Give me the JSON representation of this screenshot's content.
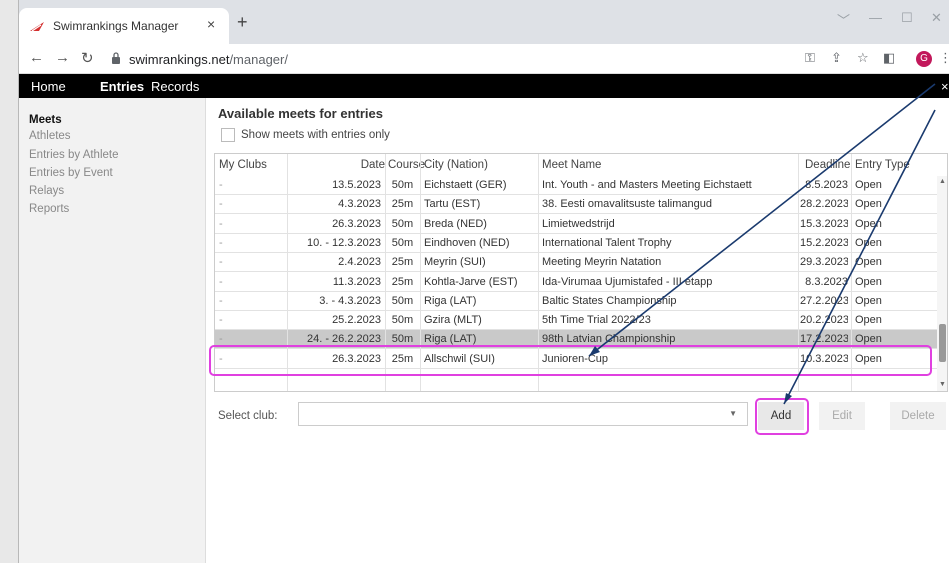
{
  "browser": {
    "tab_title": "Swimrankings Manager",
    "tab_close": "×",
    "new_tab": "+",
    "url_host": "swimrankings.net",
    "url_path": "/manager/",
    "avatar_letter": "G",
    "win_controls": [
      "﹀",
      "—",
      "☐",
      "✕"
    ]
  },
  "menubar": {
    "items": [
      {
        "label": "Home",
        "active": false
      },
      {
        "label": "Entries",
        "active": true
      },
      {
        "label": "Records",
        "active": false
      }
    ],
    "close": "×"
  },
  "sidebar": {
    "items": [
      {
        "label": "Meets",
        "active": true
      },
      {
        "label": "Athletes",
        "active": false
      },
      {
        "label": "Entries by Athlete",
        "active": false
      },
      {
        "label": "Entries by Event",
        "active": false
      },
      {
        "label": "Relays",
        "active": false
      },
      {
        "label": "Reports",
        "active": false
      }
    ]
  },
  "main": {
    "heading": "Available meets for entries",
    "checkbox_label": "Show meets with entries only",
    "columns": [
      "My Clubs",
      "Date",
      "Course",
      "City (Nation)",
      "Meet Name",
      "Deadline",
      "Entry Type"
    ],
    "rows": [
      {
        "club": "-",
        "date": "13.5.2023",
        "course": "50m",
        "city": "Eichstaett (GER)",
        "meet": "Int. Youth - and Masters Meeting Eichstaett",
        "deadline": "8.5.2023",
        "type": "Open"
      },
      {
        "club": "-",
        "date": "4.3.2023",
        "course": "25m",
        "city": "Tartu (EST)",
        "meet": "38. Eesti omavalitsuste talimangud",
        "deadline": "28.2.2023",
        "type": "Open"
      },
      {
        "club": "-",
        "date": "26.3.2023",
        "course": "50m",
        "city": "Breda (NED)",
        "meet": "Limietwedstrijd",
        "deadline": "15.3.2023",
        "type": "Open"
      },
      {
        "club": "-",
        "date": "10. - 12.3.2023",
        "course": "50m",
        "city": "Eindhoven (NED)",
        "meet": "International Talent Trophy",
        "deadline": "15.2.2023",
        "type": "Open"
      },
      {
        "club": "-",
        "date": "2.4.2023",
        "course": "25m",
        "city": "Meyrin (SUI)",
        "meet": "Meeting Meyrin Natation",
        "deadline": "29.3.2023",
        "type": "Open"
      },
      {
        "club": "-",
        "date": "11.3.2023",
        "course": "25m",
        "city": "Kohtla-Jarve (EST)",
        "meet": "Ida-Virumaa Ujumistafed - III etapp",
        "deadline": "8.3.2023",
        "type": "Open"
      },
      {
        "club": "-",
        "date": "3. - 4.3.2023",
        "course": "50m",
        "city": "Riga (LAT)",
        "meet": "Baltic States Championship",
        "deadline": "27.2.2023",
        "type": "Open"
      },
      {
        "club": "-",
        "date": "25.2.2023",
        "course": "50m",
        "city": "Gzira (MLT)",
        "meet": "5th Time Trial 2022/23",
        "deadline": "20.2.2023",
        "type": "Open"
      },
      {
        "club": "-",
        "date": "24. - 26.2.2023",
        "course": "50m",
        "city": "Riga (LAT)",
        "meet": "98th Latvian Championship",
        "deadline": "17.2.2023",
        "type": "Open",
        "selected": true
      },
      {
        "club": "-",
        "date": "26.3.2023",
        "course": "25m",
        "city": "Allschwil (SUI)",
        "meet": "Junioren-Cup",
        "deadline": "10.3.2023",
        "type": "Open"
      }
    ],
    "select_club_label": "Select club:",
    "select_club_value": "",
    "buttons": {
      "add": "Add",
      "edit": "Edit",
      "delete": "Delete"
    }
  },
  "colors": {
    "highlight": "#e040e0",
    "arrow": "#1a3a6e",
    "selected_row": "#c9c9c9"
  }
}
